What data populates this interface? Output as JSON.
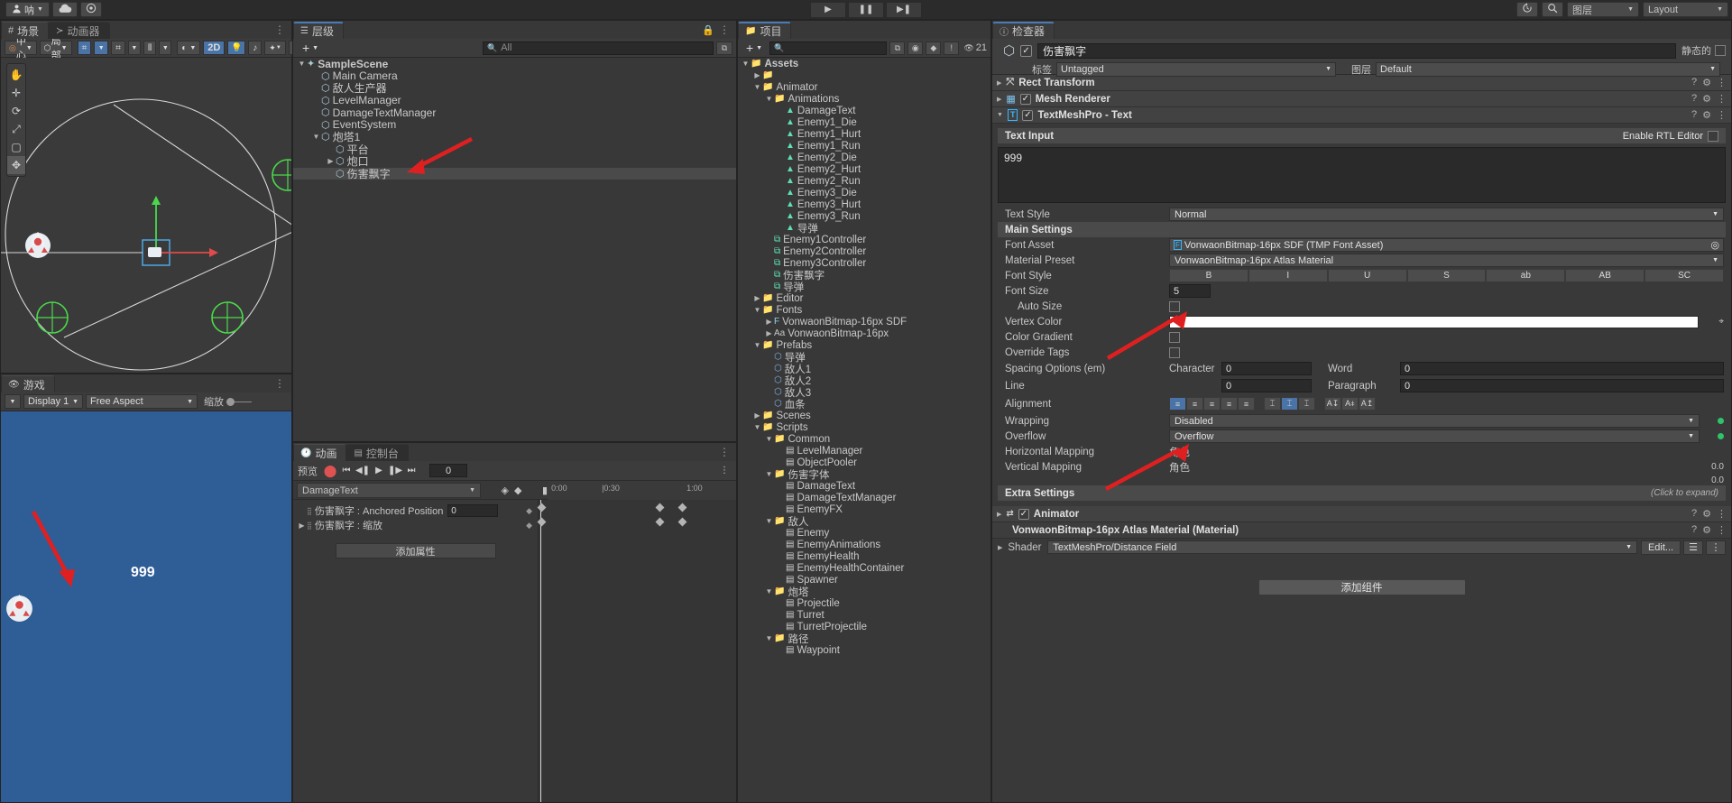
{
  "topbar": {
    "account_label": "呐",
    "cloud_icon": "cloud-icon",
    "settings_icon": "gear-icon",
    "play_icon": "▶",
    "pause_icon": "❚❚",
    "step_icon": "▶❚",
    "history_icon": "undo-history-icon",
    "search_icon": "search-icon",
    "layers_label": "图层",
    "layout_label": "Layout"
  },
  "scene": {
    "tabs": [
      {
        "label": "场景",
        "icon": "grid-icon",
        "active": true
      },
      {
        "label": "动画器",
        "icon": "animator-icon",
        "active": false
      }
    ],
    "toolbar": {
      "pivot_label": "中心",
      "space_label": "局部",
      "mode_2d": "2D",
      "grid_icon": "grid-snap-icon",
      "ruler_icon": "ruler-icon",
      "light_icon": "light-icon",
      "audio_icon": "audio-icon",
      "fx_icon": "fx-icon",
      "cam_icon": "camera-icon"
    },
    "tools": [
      "hand-tool",
      "move-tool",
      "rotate-tool",
      "scale-tool",
      "rect-tool",
      "transform-tool",
      "custom-tool"
    ]
  },
  "game": {
    "tab_label": "游戏",
    "display_label": "Display 1",
    "aspect_label": "Free Aspect",
    "scale_label": "缩放",
    "damage_text": "999"
  },
  "hierarchy": {
    "tab_label": "层级",
    "add_label": "+",
    "search_placeholder": "All",
    "items": [
      {
        "label": "SampleScene",
        "depth": 0,
        "tw": "▼",
        "icon": "unity-scene-icon",
        "bold": true,
        "selected": false
      },
      {
        "label": "Main Camera",
        "depth": 1,
        "tw": "",
        "icon": "gameobject-icon",
        "bold": false,
        "selected": false
      },
      {
        "label": "敌人生产器",
        "depth": 1,
        "tw": "",
        "icon": "gameobject-icon",
        "bold": false,
        "selected": false
      },
      {
        "label": "LevelManager",
        "depth": 1,
        "tw": "",
        "icon": "gameobject-icon",
        "bold": false,
        "selected": false
      },
      {
        "label": "DamageTextManager",
        "depth": 1,
        "tw": "",
        "icon": "gameobject-icon",
        "bold": false,
        "selected": false
      },
      {
        "label": "EventSystem",
        "depth": 1,
        "tw": "",
        "icon": "gameobject-icon",
        "bold": false,
        "selected": false
      },
      {
        "label": "炮塔1",
        "depth": 1,
        "tw": "▼",
        "icon": "gameobject-icon",
        "bold": false,
        "selected": false
      },
      {
        "label": "平台",
        "depth": 2,
        "tw": "",
        "icon": "gameobject-icon",
        "bold": false,
        "selected": false
      },
      {
        "label": "炮口",
        "depth": 2,
        "tw": "▶",
        "icon": "gameobject-icon",
        "bold": false,
        "selected": false
      },
      {
        "label": "伤害飘字",
        "depth": 2,
        "tw": "",
        "icon": "gameobject-icon",
        "bold": false,
        "selected": true
      }
    ]
  },
  "animation": {
    "tabs": [
      {
        "label": "动画",
        "icon": "clock-icon",
        "active": true
      },
      {
        "label": "控制台",
        "icon": "console-icon",
        "active": false
      }
    ],
    "preview_label": "预览",
    "record_icon": "record-icon",
    "first_frame_icon": "⏮",
    "prev_frame_icon": "◀❚",
    "play_icon": "▶",
    "next_frame_icon": "❚▶",
    "last_frame_icon": "⏭",
    "frame_value": "0",
    "clip_name": "DamageText",
    "key_icon": "diamond-key-icon",
    "add_key_icon": "add-key-icon",
    "add_event_icon": "add-event-icon",
    "ruler_ticks": [
      "0:00",
      "|0:30",
      "1:00"
    ],
    "properties": [
      {
        "label": "伤害飘字 : Anchored Position",
        "value": "0",
        "keys": [
          0,
          131,
          156
        ]
      },
      {
        "label": "伤害飘字 : 缩放",
        "value": "",
        "keys": [
          0,
          131,
          156
        ]
      }
    ],
    "add_property_label": "添加属性"
  },
  "project": {
    "tab_label": "项目",
    "add_label": "+",
    "search_placeholder": "",
    "toolbar_icons": [
      "lock-icon",
      "menu-icon",
      "favorite-icon",
      "tag-icon",
      "warning-icon",
      "hidden-icon"
    ],
    "hidden_count": "21",
    "items": [
      {
        "label": "Assets",
        "depth": 0,
        "tw": "▼",
        "icon": "folder",
        "bold": true
      },
      {
        "label": "",
        "depth": 1,
        "tw": "▶",
        "icon": "folder",
        "bold": false
      },
      {
        "label": "Animator",
        "depth": 1,
        "tw": "▼",
        "icon": "folder",
        "bold": false
      },
      {
        "label": "Animations",
        "depth": 2,
        "tw": "▼",
        "icon": "folder",
        "bold": false
      },
      {
        "label": "DamageText",
        "depth": 3,
        "tw": "",
        "icon": "anim",
        "bold": false
      },
      {
        "label": "Enemy1_Die",
        "depth": 3,
        "tw": "",
        "icon": "anim",
        "bold": false
      },
      {
        "label": "Enemy1_Hurt",
        "depth": 3,
        "tw": "",
        "icon": "anim",
        "bold": false
      },
      {
        "label": "Enemy1_Run",
        "depth": 3,
        "tw": "",
        "icon": "anim",
        "bold": false
      },
      {
        "label": "Enemy2_Die",
        "depth": 3,
        "tw": "",
        "icon": "anim",
        "bold": false
      },
      {
        "label": "Enemy2_Hurt",
        "depth": 3,
        "tw": "",
        "icon": "anim",
        "bold": false
      },
      {
        "label": "Enemy2_Run",
        "depth": 3,
        "tw": "",
        "icon": "anim",
        "bold": false
      },
      {
        "label": "Enemy3_Die",
        "depth": 3,
        "tw": "",
        "icon": "anim",
        "bold": false
      },
      {
        "label": "Enemy3_Hurt",
        "depth": 3,
        "tw": "",
        "icon": "anim",
        "bold": false
      },
      {
        "label": "Enemy3_Run",
        "depth": 3,
        "tw": "",
        "icon": "anim",
        "bold": false
      },
      {
        "label": "导弹",
        "depth": 3,
        "tw": "",
        "icon": "anim",
        "bold": false
      },
      {
        "label": "Enemy1Controller",
        "depth": 2,
        "tw": "",
        "icon": "ctrl",
        "bold": false
      },
      {
        "label": "Enemy2Controller",
        "depth": 2,
        "tw": "",
        "icon": "ctrl",
        "bold": false
      },
      {
        "label": "Enemy3Controller",
        "depth": 2,
        "tw": "",
        "icon": "ctrl",
        "bold": false
      },
      {
        "label": "伤害飘字",
        "depth": 2,
        "tw": "",
        "icon": "ctrl",
        "bold": false
      },
      {
        "label": "导弹",
        "depth": 2,
        "tw": "",
        "icon": "ctrl",
        "bold": false
      },
      {
        "label": "Editor",
        "depth": 1,
        "tw": "▶",
        "icon": "folder",
        "bold": false
      },
      {
        "label": "Fonts",
        "depth": 1,
        "tw": "▼",
        "icon": "folder",
        "bold": false
      },
      {
        "label": "VonwaonBitmap-16px SDF",
        "depth": 2,
        "tw": "▶",
        "icon": "font",
        "bold": false
      },
      {
        "label": "VonwaonBitmap-16px",
        "depth": 2,
        "tw": "▶",
        "icon": "fontaa",
        "bold": false
      },
      {
        "label": "Prefabs",
        "depth": 1,
        "tw": "▼",
        "icon": "folder",
        "bold": false
      },
      {
        "label": "导弹",
        "depth": 2,
        "tw": "",
        "icon": "prefab",
        "bold": false
      },
      {
        "label": "敌人1",
        "depth": 2,
        "tw": "",
        "icon": "prefab",
        "bold": false
      },
      {
        "label": "敌人2",
        "depth": 2,
        "tw": "",
        "icon": "prefab",
        "bold": false
      },
      {
        "label": "敌人3",
        "depth": 2,
        "tw": "",
        "icon": "prefab",
        "bold": false
      },
      {
        "label": "血条",
        "depth": 2,
        "tw": "",
        "icon": "prefab",
        "bold": false
      },
      {
        "label": "Scenes",
        "depth": 1,
        "tw": "▶",
        "icon": "folder",
        "bold": false
      },
      {
        "label": "Scripts",
        "depth": 1,
        "tw": "▼",
        "icon": "folder",
        "bold": false
      },
      {
        "label": "Common",
        "depth": 2,
        "tw": "▼",
        "icon": "folder",
        "bold": false
      },
      {
        "label": "LevelManager",
        "depth": 3,
        "tw": "",
        "icon": "script",
        "bold": false
      },
      {
        "label": "ObjectPooler",
        "depth": 3,
        "tw": "",
        "icon": "script",
        "bold": false
      },
      {
        "label": "伤害字体",
        "depth": 2,
        "tw": "▼",
        "icon": "folder",
        "bold": false
      },
      {
        "label": "DamageText",
        "depth": 3,
        "tw": "",
        "icon": "script",
        "bold": false
      },
      {
        "label": "DamageTextManager",
        "depth": 3,
        "tw": "",
        "icon": "script",
        "bold": false
      },
      {
        "label": "EnemyFX",
        "depth": 3,
        "tw": "",
        "icon": "script",
        "bold": false
      },
      {
        "label": "敌人",
        "depth": 2,
        "tw": "▼",
        "icon": "folder",
        "bold": false
      },
      {
        "label": "Enemy",
        "depth": 3,
        "tw": "",
        "icon": "script",
        "bold": false
      },
      {
        "label": "EnemyAnimations",
        "depth": 3,
        "tw": "",
        "icon": "script",
        "bold": false
      },
      {
        "label": "EnemyHealth",
        "depth": 3,
        "tw": "",
        "icon": "script",
        "bold": false
      },
      {
        "label": "EnemyHealthContainer",
        "depth": 3,
        "tw": "",
        "icon": "script",
        "bold": false
      },
      {
        "label": "Spawner",
        "depth": 3,
        "tw": "",
        "icon": "script",
        "bold": false
      },
      {
        "label": "炮塔",
        "depth": 2,
        "tw": "▼",
        "icon": "folder",
        "bold": false
      },
      {
        "label": "Projectile",
        "depth": 3,
        "tw": "",
        "icon": "script",
        "bold": false
      },
      {
        "label": "Turret",
        "depth": 3,
        "tw": "",
        "icon": "script",
        "bold": false
      },
      {
        "label": "TurretProjectile",
        "depth": 3,
        "tw": "",
        "icon": "script",
        "bold": false
      },
      {
        "label": "路径",
        "depth": 2,
        "tw": "▼",
        "icon": "folder",
        "bold": false
      },
      {
        "label": "Waypoint",
        "depth": 3,
        "tw": "",
        "icon": "script",
        "bold": false
      }
    ]
  },
  "inspector": {
    "tab_label": "检查器",
    "object_name": "伤害飘字",
    "static_label": "静态的",
    "tag_label": "标签",
    "tag_value": "Untagged",
    "layer_label": "图层",
    "layer_value": "Default",
    "components": [
      {
        "name": "Rect Transform",
        "icon": "rect-transform-icon",
        "has_checkbox": false,
        "expanded": false
      },
      {
        "name": "Mesh Renderer",
        "icon": "mesh-renderer-icon",
        "has_checkbox": true,
        "expanded": false
      },
      {
        "name": "TextMeshPro - Text",
        "icon": "tmp-icon",
        "has_checkbox": true,
        "expanded": true
      }
    ],
    "tmp": {
      "text_input_header": "Text Input",
      "enable_rtl_label": "Enable RTL Editor",
      "text_value": "999",
      "text_style_label": "Text Style",
      "text_style_value": "Normal",
      "main_settings_header": "Main Settings",
      "font_asset_label": "Font Asset",
      "font_asset_value": "VonwaonBitmap-16px SDF (TMP Font Asset)",
      "material_preset_label": "Material Preset",
      "material_preset_value": "VonwaonBitmap-16px Atlas Material",
      "font_style_label": "Font Style",
      "font_style_buttons": [
        "B",
        "I",
        "U",
        "S",
        "ab",
        "AB",
        "SC"
      ],
      "font_size_label": "Font Size",
      "font_size_value": "5",
      "auto_size_label": "Auto Size",
      "vertex_color_label": "Vertex Color",
      "vertex_color_hex": "#FFFFFF",
      "color_gradient_label": "Color Gradient",
      "override_tags_label": "Override Tags",
      "spacing_label": "Spacing Options (em)",
      "spacing_character_label": "Character",
      "spacing_character_value": "0",
      "spacing_word_label": "Word",
      "spacing_word_value": "0",
      "spacing_line_label": "Line",
      "spacing_line_value": "0",
      "spacing_paragraph_label": "Paragraph",
      "spacing_paragraph_value": "0",
      "alignment_label": "Alignment",
      "wrapping_label": "Wrapping",
      "wrapping_value": "Disabled",
      "overflow_label": "Overflow",
      "overflow_value": "Overflow",
      "horizontal_mapping_label": "Horizontal Mapping",
      "horizontal_mapping_value": "角色",
      "vertical_mapping_label": "Vertical Mapping",
      "vertical_mapping_value": "角色",
      "vm_num1": "0.0",
      "vm_num2": "0.0",
      "extra_settings_header": "Extra Settings",
      "extra_settings_hint": "(Click to expand)"
    },
    "animator": {
      "name": "Animator",
      "icon": "animator-component-icon",
      "material_name": "VonwaonBitmap-16px Atlas Material (Material)",
      "shader_label": "Shader",
      "shader_value": "TextMeshPro/Distance Field",
      "edit_label": "Edit..."
    },
    "add_component_label": "添加组件"
  }
}
